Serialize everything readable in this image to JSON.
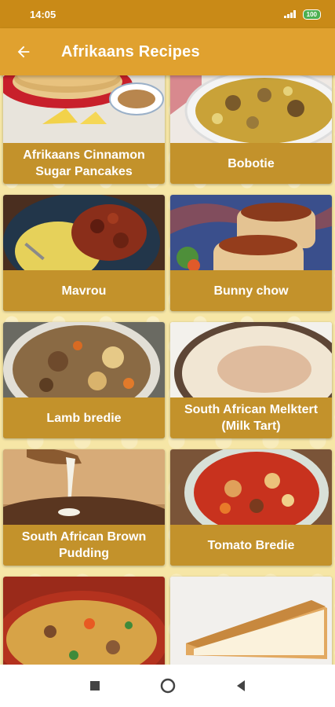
{
  "status_bar": {
    "time": "14:05",
    "battery": "100"
  },
  "app_bar": {
    "title": "Afrikaans Recipes",
    "back_icon": "arrow-left-icon"
  },
  "colors": {
    "status_bar": "#c98a17",
    "app_bar": "#e0a12f",
    "card_label": "#c3922b",
    "background": "#f6e6a6"
  },
  "recipes": [
    {
      "name": "Afrikaans Cinnamon Sugar Pancakes"
    },
    {
      "name": "Bobotie"
    },
    {
      "name": "Mavrou"
    },
    {
      "name": "Bunny chow"
    },
    {
      "name": "Lamb bredie"
    },
    {
      "name": "South African Melktert (Milk Tart)"
    },
    {
      "name": "South African Brown Pudding"
    },
    {
      "name": "Tomato Bredie"
    }
  ],
  "nav_bar": {
    "recents_icon": "square-icon",
    "home_icon": "circle-icon",
    "back_icon": "triangle-back-icon"
  }
}
